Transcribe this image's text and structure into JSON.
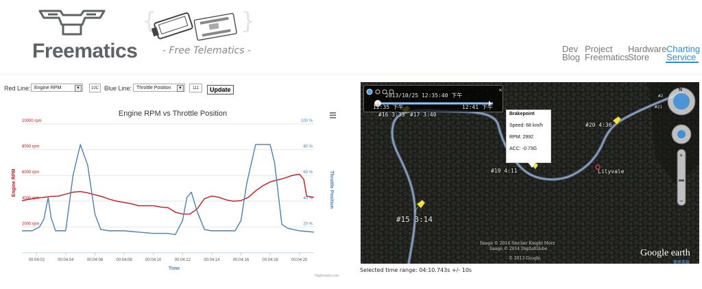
{
  "header": {
    "logo_text": "Freematics",
    "banner_tagline": "- Free Telematics -",
    "nav": [
      {
        "line1": "Dev",
        "line2": "Blog"
      },
      {
        "line1": "Project",
        "line2": "Freematics"
      },
      {
        "line1": "Hardware",
        "line2": "Store"
      },
      {
        "line1": "Charting",
        "line2": "Service"
      }
    ]
  },
  "controls": {
    "red_label": "Red Line:",
    "red_select": "Engine RPM",
    "red_pid": "10C",
    "blue_label": "Blue Line:",
    "blue_select": "Throttle Position",
    "blue_pid": "111",
    "update": "Update"
  },
  "chart_data": {
    "type": "line",
    "title": "Engine RPM vs Throttle Position",
    "xlabel": "Time",
    "ylabel_left": "Engine RPM",
    "ylabel_right": "Throttle Position",
    "credits": "Highcharts.com",
    "left_ticks": [
      "2000 rpm",
      "4000 rpm",
      "6000 rpm",
      "8000 rpm",
      "10000 rpm"
    ],
    "right_ticks": [
      "20 %",
      "40 %",
      "60 %",
      "80 %",
      "100 %"
    ],
    "x_ticks": [
      "00:04:02",
      "00:04:04",
      "00:04:06",
      "00:04:08",
      "00:04:10",
      "00:04:12",
      "00:04:14",
      "00:04:16",
      "00:04:18",
      "00:04:20"
    ],
    "xlim": [
      1,
      21
    ],
    "ylim_left": [
      0,
      10000
    ],
    "ylim_right": [
      0,
      100
    ],
    "series": [
      {
        "name": "Engine RPM",
        "color": "#c4161c",
        "axis": "left",
        "x": [
          1,
          1.5,
          2,
          2.5,
          3,
          3.5,
          4,
          4.5,
          5,
          5.5,
          6,
          6.5,
          7,
          7.5,
          8,
          8.5,
          9,
          9.5,
          10,
          10.5,
          11,
          11.5,
          12,
          12.5,
          13,
          13.5,
          14,
          14.5,
          15,
          15.5,
          16,
          16.5,
          17,
          17.5,
          18,
          18.5,
          19,
          19.5,
          20,
          20.3,
          20.5,
          21
        ],
        "y": [
          4050,
          4150,
          4250,
          4300,
          4380,
          4400,
          4550,
          4700,
          4750,
          4650,
          4500,
          4350,
          4150,
          4000,
          3900,
          3800,
          3650,
          3650,
          3650,
          3550,
          3500,
          3150,
          3000,
          3000,
          3400,
          4200,
          4400,
          4300,
          4100,
          4000,
          4050,
          4300,
          4800,
          5200,
          5500,
          5650,
          5800,
          6000,
          6100,
          5700,
          4400,
          4300
        ]
      },
      {
        "name": "Throttle Position",
        "color": "#4a7fb0",
        "axis": "right",
        "y_percent": true,
        "x": [
          1,
          1.7,
          2.2,
          2.5,
          2.8,
          3.0,
          3.3,
          3.6,
          4,
          4.5,
          5,
          5.5,
          6,
          6.4,
          7,
          8,
          9,
          10,
          11,
          11.5,
          12,
          12.3,
          12.6,
          13,
          13.5,
          14,
          15,
          15.6,
          16.0,
          16.4,
          17,
          17.7,
          18.0,
          18.3,
          18.8,
          19.2,
          19.6,
          20,
          21
        ],
        "y": [
          17,
          17,
          20,
          26,
          43,
          27,
          17,
          17,
          17,
          60,
          84,
          68,
          30,
          18,
          17,
          17,
          16,
          15,
          15,
          14,
          25,
          43,
          47,
          32,
          18,
          17,
          17,
          17,
          25,
          54,
          84,
          84,
          84,
          70,
          22,
          19,
          18,
          17,
          16
        ]
      }
    ]
  },
  "map": {
    "playback_time": "2013/10/25  12:35:40 下午",
    "range_start": "12:35 下午",
    "range_end": "12:41 下午",
    "tooltip": {
      "title": "Brakepoint",
      "speed": "Speed: 68 km/h",
      "rpm": "RPM: 2992",
      "acc": "ACC: -0.73G"
    },
    "labels": [
      "#16 3:33",
      "#17 3:40",
      "#19 4:11",
      "#20 4:36",
      "#15 3:14",
      "Lilyvale",
      "#21",
      "#2"
    ],
    "credits": [
      "Image © 2014 Sinclair Knight Merz",
      "Image © 2014 DigitalGlobe",
      "© 2013 Google"
    ],
    "brand": "Google earth",
    "terms": "使用条款"
  },
  "status": "Selected time range: 04:10.743s +/- 10s"
}
